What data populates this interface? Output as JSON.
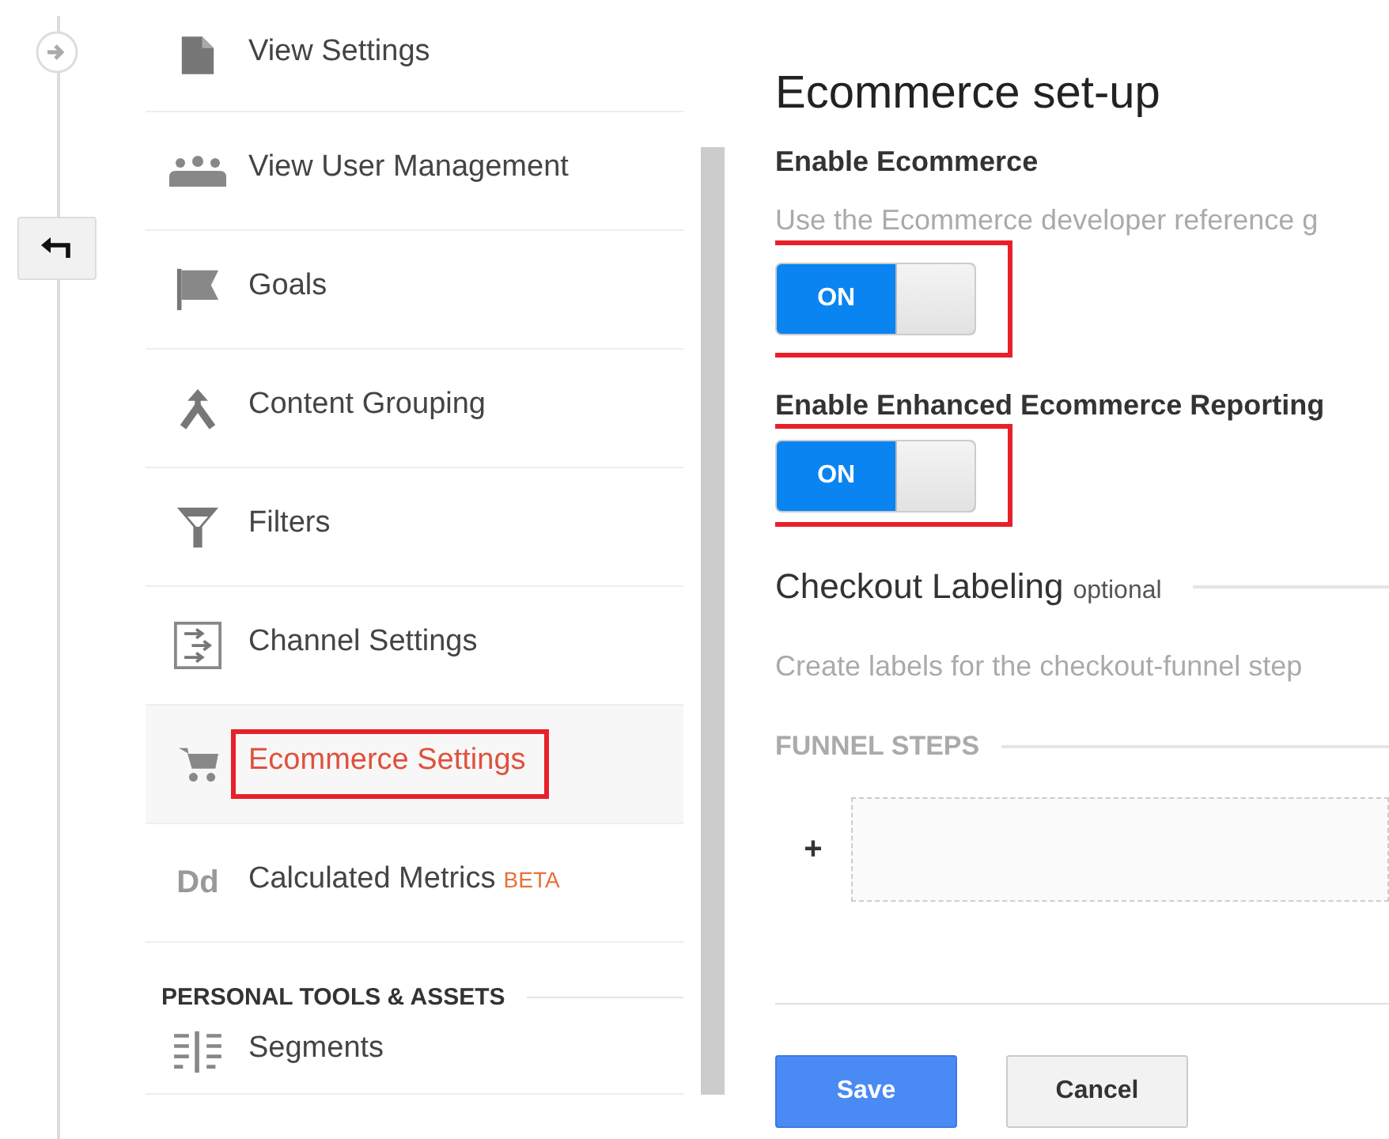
{
  "sidebar": {
    "items": [
      {
        "kind": "document",
        "label": "View Settings",
        "selected": false,
        "highlighted": false
      },
      {
        "kind": "people",
        "label": "View User Management",
        "selected": false,
        "highlighted": false
      },
      {
        "kind": "flag",
        "label": "Goals",
        "selected": false,
        "highlighted": false
      },
      {
        "kind": "merge",
        "label": "Content Grouping",
        "selected": false,
        "highlighted": false
      },
      {
        "kind": "funnel",
        "label": "Filters",
        "selected": false,
        "highlighted": false
      },
      {
        "kind": "channel",
        "label": "Channel Settings",
        "selected": false,
        "highlighted": false
      },
      {
        "kind": "cart",
        "label": "Ecommerce Settings",
        "selected": true,
        "highlighted": true
      },
      {
        "kind": "letters",
        "icon_text": "Dd",
        "label": "Calculated Metrics",
        "badge": "BETA",
        "selected": false,
        "highlighted": false
      }
    ],
    "section_heading": "PERSONAL TOOLS & ASSETS",
    "section_items": [
      {
        "kind": "segments",
        "label": "Segments",
        "selected": false,
        "highlighted": false
      }
    ]
  },
  "main": {
    "title": "Ecommerce set-up",
    "settings": [
      {
        "label": "Enable Ecommerce",
        "description": "Use the Ecommerce developer reference g",
        "toggle": "ON",
        "on": true,
        "highlighted": true
      },
      {
        "label": "Enable Enhanced Ecommerce Reporting",
        "toggle": "ON",
        "on": true,
        "highlighted": true
      }
    ],
    "checkout": {
      "title": "Checkout Labeling",
      "note": "optional",
      "description": "Create labels for the checkout-funnel step",
      "funnel_heading": "FUNNEL STEPS",
      "add": "+"
    },
    "buttons": [
      {
        "kind": "primary",
        "label": "Save"
      },
      {
        "kind": "secondary",
        "label": "Cancel"
      }
    ]
  }
}
